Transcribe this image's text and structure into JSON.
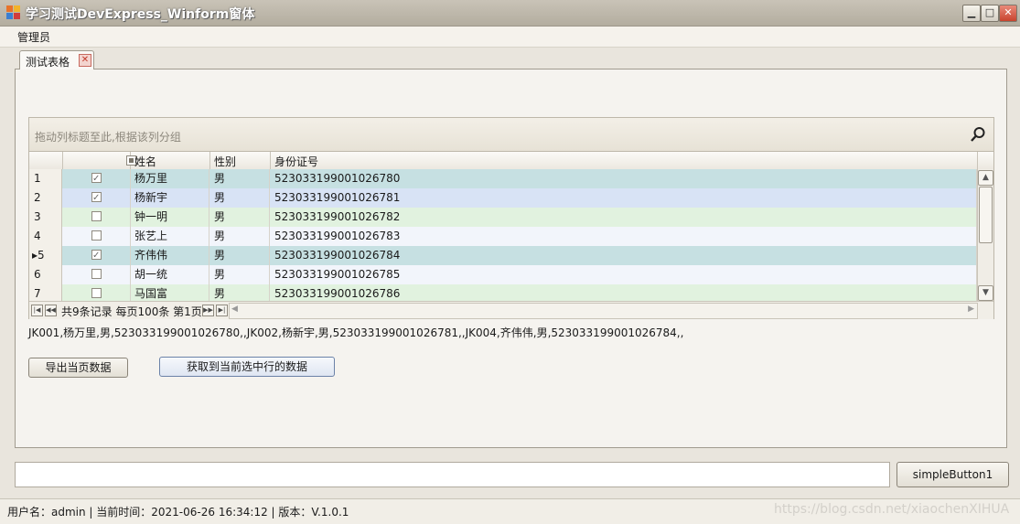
{
  "window": {
    "title": "学习测试DevExpress_Winform窗体"
  },
  "menu": {
    "items": [
      "管理员"
    ]
  },
  "tab": {
    "label": "测试表格"
  },
  "grid": {
    "group_hint": "拖动列标题至此,根据该列分组",
    "columns": [
      "",
      "",
      "姓名",
      "性别",
      "身份证号"
    ],
    "rows": [
      {
        "num": "1",
        "checked": true,
        "name": "杨万里",
        "gender": "男",
        "id": "523033199001026780",
        "bg": "#c6e0e2"
      },
      {
        "num": "2",
        "checked": true,
        "name": "杨新宇",
        "gender": "男",
        "id": "523033199001026781",
        "bg": "#d8e3f5"
      },
      {
        "num": "3",
        "checked": false,
        "name": "钟一明",
        "gender": "男",
        "id": "523033199001026782",
        "bg": "#e1f2df"
      },
      {
        "num": "4",
        "checked": false,
        "name": "张艺上",
        "gender": "男",
        "id": "523033199001026783",
        "bg": "#f2f5fb"
      },
      {
        "num": "5",
        "checked": true,
        "name": "齐伟伟",
        "gender": "男",
        "id": "523033199001026784",
        "bg": "#c6e0e2",
        "focused": true
      },
      {
        "num": "6",
        "checked": false,
        "name": "胡一统",
        "gender": "男",
        "id": "523033199001026785",
        "bg": "#f2f5fb"
      },
      {
        "num": "7",
        "checked": false,
        "name": "马国富",
        "gender": "男",
        "id": "523033199001026786",
        "bg": "#e1f2df"
      }
    ],
    "navigator_text": "共9条记录 每页100条 第1页"
  },
  "selected_text": "JK001,杨万里,男,523033199001026780,,JK002,杨新宇,男,523033199001026781,,JK004,齐伟伟,男,523033199001026784,,",
  "buttons": {
    "export": "导出当页数据",
    "get_selected": "获取到当前选中行的数据",
    "simple": "simpleButton1"
  },
  "status": {
    "text": "用户名：admin  |   当前时间：2021-06-26 16:34:12   |   版本：V.1.0.1"
  },
  "watermark": "https://blog.csdn.net/xiaochenXIHUA"
}
